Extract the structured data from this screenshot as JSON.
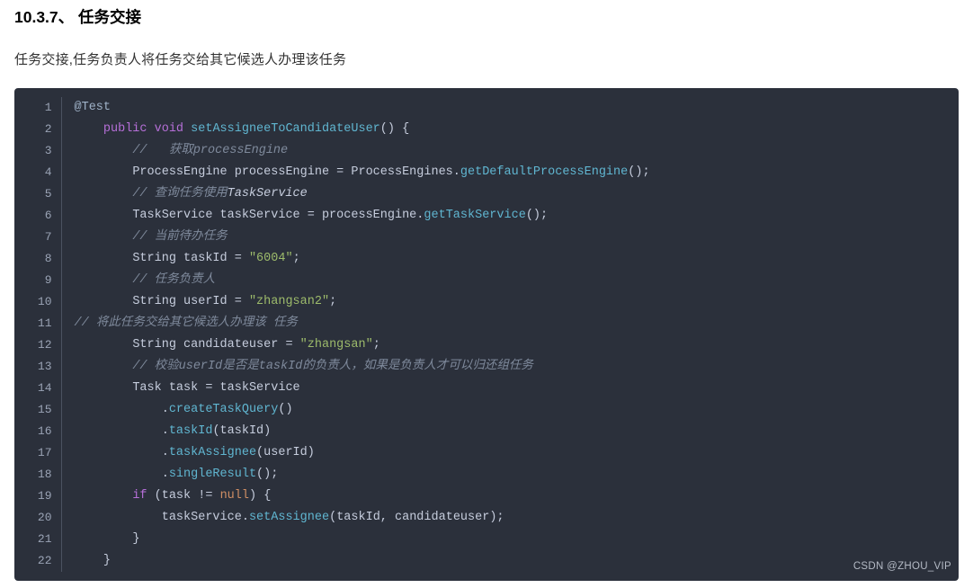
{
  "heading": "10.3.7、 任务交接",
  "paragraph": "任务交接,任务负责人将任务交给其它候选人办理该任务",
  "watermark": "CSDN @ZHOU_VIP",
  "code": {
    "lines": [
      {
        "num": 1,
        "indent": "",
        "tokens": [
          [
            "annot",
            "@Test"
          ]
        ]
      },
      {
        "num": 2,
        "indent": "    ",
        "tokens": [
          [
            "kw",
            "public"
          ],
          [
            "plain",
            " "
          ],
          [
            "kw",
            "void"
          ],
          [
            "plain",
            " "
          ],
          [
            "fn",
            "setAssigneeToCandidateUser"
          ],
          [
            "punc",
            "()"
          ],
          [
            "plain",
            " "
          ],
          [
            "punc",
            "{"
          ]
        ]
      },
      {
        "num": 3,
        "indent": "        ",
        "tokens": [
          [
            "com",
            "//   获取processEngine"
          ]
        ]
      },
      {
        "num": 4,
        "indent": "        ",
        "tokens": [
          [
            "plain",
            "ProcessEngine processEngine "
          ],
          [
            "op",
            "="
          ],
          [
            "plain",
            " ProcessEngines"
          ],
          [
            "punc",
            "."
          ],
          [
            "fn",
            "getDefaultProcessEngine"
          ],
          [
            "punc",
            "();"
          ]
        ]
      },
      {
        "num": 5,
        "indent": "        ",
        "tokens": [
          [
            "com",
            "// 查询任务使用"
          ],
          [
            "eng",
            "TaskService"
          ]
        ]
      },
      {
        "num": 6,
        "indent": "        ",
        "tokens": [
          [
            "plain",
            "TaskService taskService "
          ],
          [
            "op",
            "="
          ],
          [
            "plain",
            " processEngine"
          ],
          [
            "punc",
            "."
          ],
          [
            "fn",
            "getTaskService"
          ],
          [
            "punc",
            "();"
          ]
        ]
      },
      {
        "num": 7,
        "indent": "        ",
        "tokens": [
          [
            "com",
            "// 当前待办任务"
          ]
        ]
      },
      {
        "num": 8,
        "indent": "        ",
        "tokens": [
          [
            "plain",
            "String taskId "
          ],
          [
            "op",
            "="
          ],
          [
            "plain",
            " "
          ],
          [
            "str",
            "\"6004\""
          ],
          [
            "punc",
            ";"
          ]
        ]
      },
      {
        "num": 9,
        "indent": "        ",
        "tokens": [
          [
            "com",
            "// 任务负责人"
          ]
        ]
      },
      {
        "num": 10,
        "indent": "        ",
        "tokens": [
          [
            "plain",
            "String userId "
          ],
          [
            "op",
            "="
          ],
          [
            "plain",
            " "
          ],
          [
            "str",
            "\"zhangsan2\""
          ],
          [
            "punc",
            ";"
          ]
        ]
      },
      {
        "num": 11,
        "indent": "",
        "tokens": [
          [
            "com",
            "// 将此任务交给其它候选人办理该 任务"
          ]
        ]
      },
      {
        "num": 12,
        "indent": "        ",
        "tokens": [
          [
            "plain",
            "String candidateuser "
          ],
          [
            "op",
            "="
          ],
          [
            "plain",
            " "
          ],
          [
            "str",
            "\"zhangsan\""
          ],
          [
            "punc",
            ";"
          ]
        ]
      },
      {
        "num": 13,
        "indent": "        ",
        "tokens": [
          [
            "com",
            "// 校验userId是否是taskId的负责人，如果是负责人才可以归还组任务"
          ]
        ]
      },
      {
        "num": 14,
        "indent": "        ",
        "tokens": [
          [
            "plain",
            "Task task "
          ],
          [
            "op",
            "="
          ],
          [
            "plain",
            " taskService"
          ]
        ]
      },
      {
        "num": 15,
        "indent": "            ",
        "tokens": [
          [
            "punc",
            "."
          ],
          [
            "fn",
            "createTaskQuery"
          ],
          [
            "punc",
            "()"
          ]
        ]
      },
      {
        "num": 16,
        "indent": "            ",
        "tokens": [
          [
            "punc",
            "."
          ],
          [
            "fn",
            "taskId"
          ],
          [
            "punc",
            "("
          ],
          [
            "plain",
            "taskId"
          ],
          [
            "punc",
            ")"
          ]
        ]
      },
      {
        "num": 17,
        "indent": "            ",
        "tokens": [
          [
            "punc",
            "."
          ],
          [
            "fn",
            "taskAssignee"
          ],
          [
            "punc",
            "("
          ],
          [
            "plain",
            "userId"
          ],
          [
            "punc",
            ")"
          ]
        ]
      },
      {
        "num": 18,
        "indent": "            ",
        "tokens": [
          [
            "punc",
            "."
          ],
          [
            "fn",
            "singleResult"
          ],
          [
            "punc",
            "();"
          ]
        ]
      },
      {
        "num": 19,
        "indent": "        ",
        "tokens": [
          [
            "kw",
            "if"
          ],
          [
            "plain",
            " "
          ],
          [
            "punc",
            "("
          ],
          [
            "plain",
            "task "
          ],
          [
            "op",
            "!="
          ],
          [
            "plain",
            " "
          ],
          [
            "null",
            "null"
          ],
          [
            "punc",
            ")"
          ],
          [
            "plain",
            " "
          ],
          [
            "punc",
            "{"
          ]
        ]
      },
      {
        "num": 20,
        "indent": "            ",
        "tokens": [
          [
            "plain",
            "taskService"
          ],
          [
            "punc",
            "."
          ],
          [
            "fn",
            "setAssignee"
          ],
          [
            "punc",
            "("
          ],
          [
            "plain",
            "taskId"
          ],
          [
            "punc",
            ","
          ],
          [
            "plain",
            " candidateuser"
          ],
          [
            "punc",
            ");"
          ]
        ]
      },
      {
        "num": 21,
        "indent": "        ",
        "tokens": [
          [
            "punc",
            "}"
          ]
        ]
      },
      {
        "num": 22,
        "indent": "    ",
        "tokens": [
          [
            "punc",
            "}"
          ]
        ]
      }
    ]
  }
}
